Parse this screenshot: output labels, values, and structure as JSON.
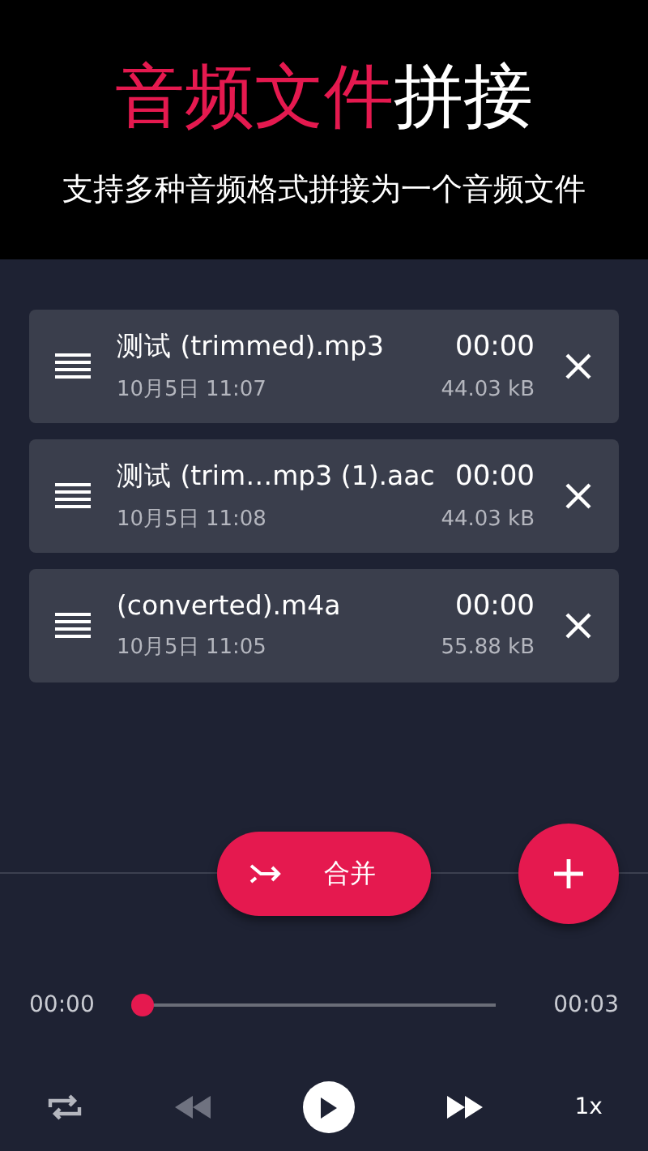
{
  "header": {
    "title": [
      {
        "text": "音频文件",
        "accent": true
      },
      {
        "text": "拼接",
        "accent": false
      }
    ],
    "subtitle": "支持多种音频格式拼接为一个音频文件"
  },
  "files": [
    {
      "name": "测试 (trimmed).mp3",
      "date": "10月5日 11:07",
      "duration": "00:00",
      "size": "44.03 kB"
    },
    {
      "name": "测试 (trim…mp3 (1).aac",
      "date": "10月5日 11:08",
      "duration": "00:00",
      "size": "44.03 kB"
    },
    {
      "name": "(converted).m4a",
      "date": "10月5日 11:05",
      "duration": "00:00",
      "size": "55.88 kB"
    }
  ],
  "merge_button": {
    "label": "合并"
  },
  "player": {
    "elapsed": "00:00",
    "total": "00:03",
    "level": 0,
    "speed": "1x",
    "rewind_disabled": true
  }
}
